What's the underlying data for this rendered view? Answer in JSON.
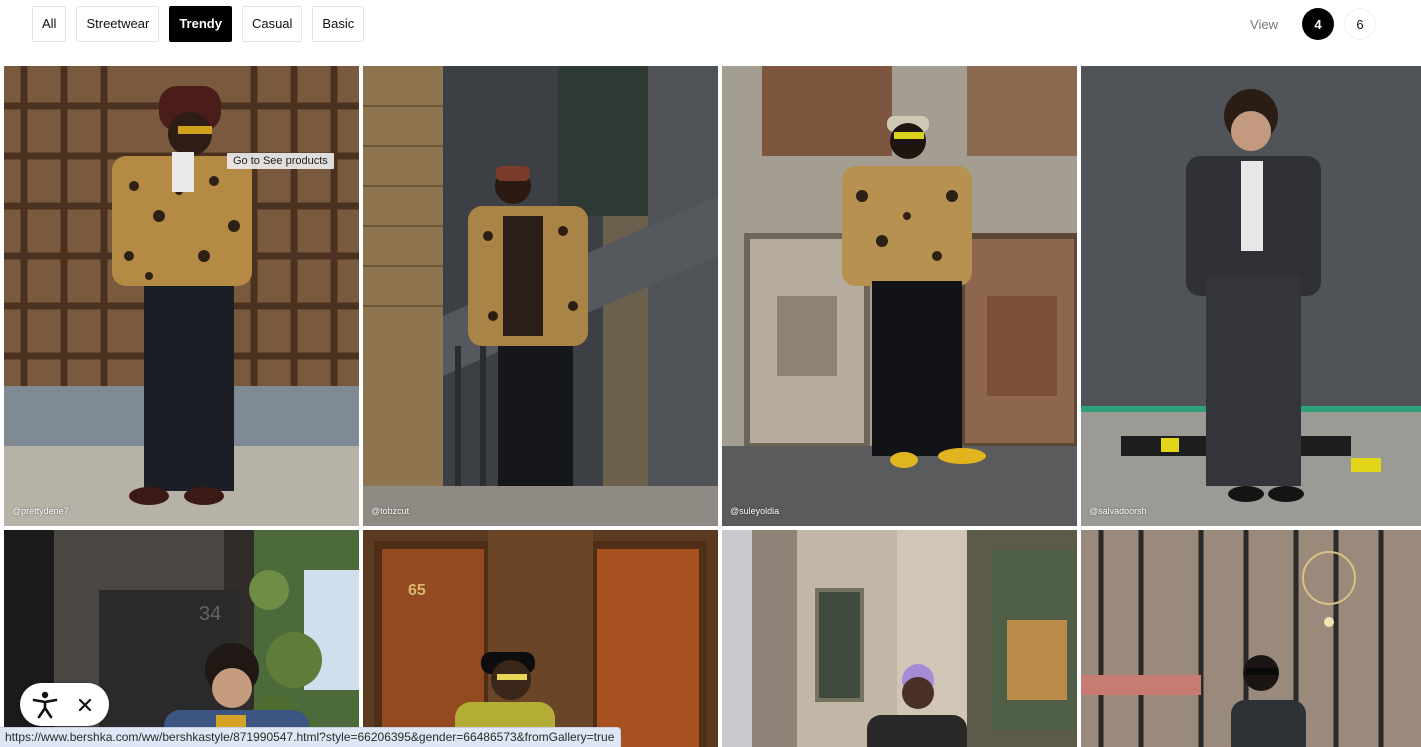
{
  "filters": [
    {
      "label": "All",
      "active": false
    },
    {
      "label": "Streetwear",
      "active": false
    },
    {
      "label": "Trendy",
      "active": true
    },
    {
      "label": "Casual",
      "active": false
    },
    {
      "label": "Basic",
      "active": false
    }
  ],
  "view": {
    "label": "View",
    "options": [
      "4",
      "6"
    ],
    "selected": "4"
  },
  "tooltip": "Go to See products",
  "looks": [
    {
      "handle": "@prettydene7"
    },
    {
      "handle": "@tobzcut"
    },
    {
      "handle": "@suleyoldia"
    },
    {
      "handle": "@salvadoorsh"
    },
    {
      "handle": ""
    },
    {
      "handle": ""
    },
    {
      "handle": ""
    },
    {
      "handle": ""
    }
  ],
  "door_number": "65",
  "wall_number": "34",
  "accessibility": {
    "icon": "accessibility-icon",
    "close_icon": "close-icon"
  },
  "status_url": "https://www.bershka.com/ww/bershkastyle/871990547.html?style=66206395&gender=66486573&fromGallery=true"
}
